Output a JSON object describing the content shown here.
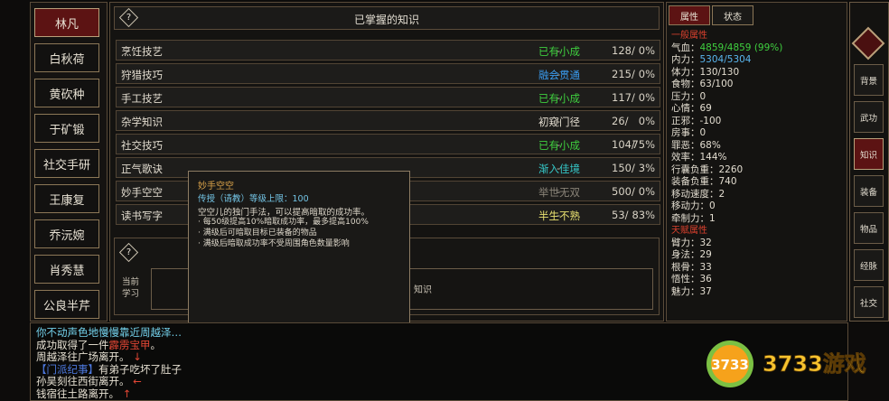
{
  "characters": [
    "林凡",
    "白秋荷",
    "黄砍种",
    "于矿锻",
    "社交手研",
    "王康复",
    "乔沅婉",
    "肖秀慧",
    "公良半芹"
  ],
  "knowledge": {
    "title": "已掌握的知识",
    "rows": [
      {
        "name": "烹饪技艺",
        "level": "已有小成",
        "color": "#3fcf3f",
        "progress": "128/",
        "pct": "0%"
      },
      {
        "name": "狩猎技巧",
        "level": "融会贯通",
        "color": "#3a9cf0",
        "progress": "215/",
        "pct": "0%"
      },
      {
        "name": "手工技艺",
        "level": "已有小成",
        "color": "#3fcf3f",
        "progress": "117/",
        "pct": "0%"
      },
      {
        "name": "杂学知识",
        "level": "初窥门径",
        "color": "#e3ddd0",
        "progress": "26/",
        "pct": "0%"
      },
      {
        "name": "社交技巧",
        "level": "已有小成",
        "color": "#3fcf3f",
        "progress": "104/",
        "pct": "75%"
      },
      {
        "name": "正气歌诀",
        "level": "渐入佳境",
        "color": "#35c8c8",
        "progress": "150/",
        "pct": "3%"
      },
      {
        "name": "妙手空空",
        "level": "举世无双",
        "color": "#8a8478",
        "progress": "500/",
        "pct": "0%"
      },
      {
        "name": "读书写字",
        "level": "半生不熟",
        "color": "#e8e070",
        "progress": "53/",
        "pct": "83%"
      }
    ],
    "dash": "-",
    "study_label_1": "当前",
    "study_label_2": "学习",
    "study_hint": "知识"
  },
  "tooltip": {
    "title": "妙手空空",
    "subtitle": "传授（请教）等级上限：100",
    "desc": "空空儿的独门手法，可以提高暗取的成功率。",
    "bullets": [
      "· 每50级提高10%暗取成功率，最多提高100%",
      "· 满级后可暗取目标已装备的物品",
      "· 满级后暗取成功率不受周围角色数量影响"
    ],
    "seal": "传授"
  },
  "attr_tabs": [
    "属性",
    "状态"
  ],
  "attributes": {
    "general_title": "一般属性",
    "general": [
      {
        "k": "气血：",
        "v": "4859/4859 (99%)",
        "color": "#3fcf3f"
      },
      {
        "k": "内力：",
        "v": "5304/5304",
        "color": "#5ab6ef"
      },
      {
        "k": "体力：",
        "v": "130/130",
        "color": "#e3ddd0"
      },
      {
        "k": "食物：",
        "v": "63/100",
        "color": "#e3ddd0"
      },
      {
        "k": "压力：",
        "v": "0",
        "color": "#e3ddd0"
      },
      {
        "k": "心情：",
        "v": "69",
        "color": "#e3ddd0"
      },
      {
        "k": "正邪：",
        "v": "-100",
        "color": "#e3ddd0"
      },
      {
        "k": "房事：",
        "v": "0",
        "color": "#e3ddd0"
      },
      {
        "k": "罪恶：",
        "v": "68%",
        "color": "#e3ddd0"
      },
      {
        "k": "效率：",
        "v": "144%",
        "color": "#e3ddd0"
      },
      {
        "k": "行囊负重：",
        "v": "2260",
        "color": "#e3ddd0"
      },
      {
        "k": "装备负重：",
        "v": "740",
        "color": "#e3ddd0"
      },
      {
        "k": "移动速度：",
        "v": "2",
        "color": "#e3ddd0"
      },
      {
        "k": "移动力：",
        "v": "0",
        "color": "#e3ddd0"
      },
      {
        "k": "牵制力：",
        "v": "1",
        "color": "#e3ddd0"
      }
    ],
    "talent_title": "天赋属性",
    "talent": [
      {
        "k": "臂力：",
        "v": "32"
      },
      {
        "k": "身法：",
        "v": "29"
      },
      {
        "k": "根骨：",
        "v": "33"
      },
      {
        "k": "悟性：",
        "v": "36"
      },
      {
        "k": "魅力：",
        "v": "37"
      }
    ]
  },
  "nav": [
    "背景",
    "武功",
    "知识",
    "装备",
    "物品",
    "经脉",
    "社交"
  ],
  "log": [
    [
      {
        "t": "你不动声色地慢慢靠近周越泽…",
        "c": "cyan"
      }
    ],
    [
      {
        "t": "成功取得了一件",
        "c": "white"
      },
      {
        "t": "霹雳宝甲",
        "c": "red"
      },
      {
        "t": "。",
        "c": "white"
      }
    ],
    [
      {
        "t": "周越泽往广场离开。",
        "c": "white"
      },
      {
        "t": " ↓",
        "c": "red"
      }
    ],
    [
      {
        "t": "【门派纪事】",
        "c": "blue"
      },
      {
        "t": "有弟子吃坏了肚子",
        "c": "white"
      }
    ],
    [
      {
        "t": "孙昊刻往西街离开。",
        "c": "white"
      },
      {
        "t": " ←",
        "c": "red"
      }
    ],
    [
      {
        "t": "钱宿往土路离开。",
        "c": "white"
      },
      {
        "t": " ↑",
        "c": "red"
      }
    ]
  ],
  "watermark": {
    "left": "3733",
    "right": "3733游戏"
  }
}
